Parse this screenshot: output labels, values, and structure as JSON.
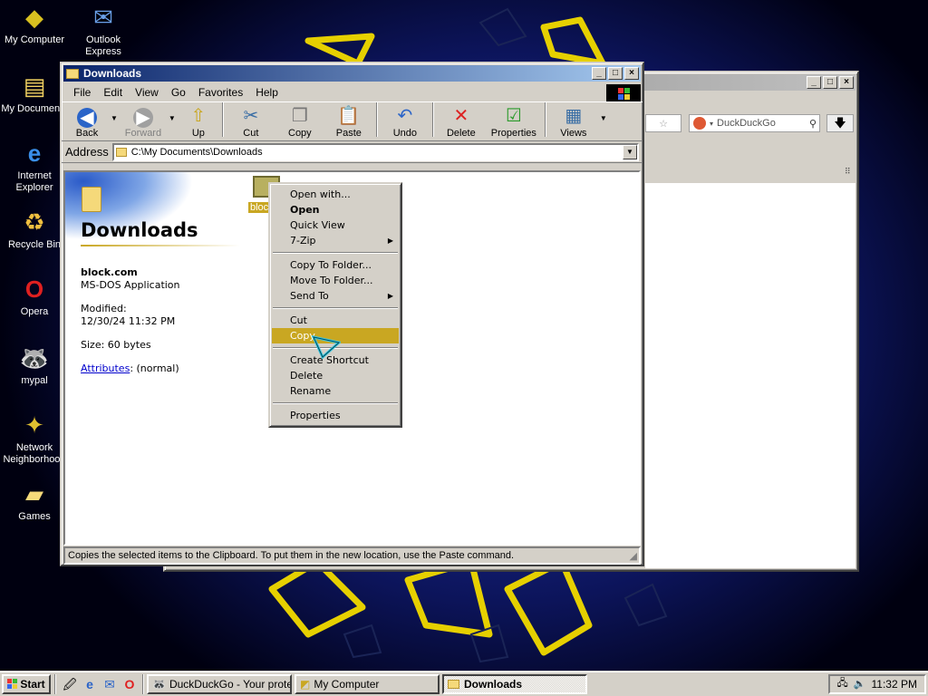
{
  "desktop": {
    "icons": [
      {
        "label": "My Computer",
        "icon": "my-computer-icon"
      },
      {
        "label": "Outlook Express",
        "icon": "outlook-express-icon"
      },
      {
        "label": "My Documents",
        "icon": "my-documents-icon"
      },
      {
        "label": "Internet Explorer",
        "icon": "internet-explorer-icon"
      },
      {
        "label": "Recycle Bin",
        "icon": "recycle-bin-icon"
      },
      {
        "label": "Opera",
        "icon": "opera-icon"
      },
      {
        "label": "mypal",
        "icon": "mypal-icon"
      },
      {
        "label": "Network Neighborhood",
        "icon": "network-neighborhood-icon"
      },
      {
        "label": "Games",
        "icon": "games-folder-icon"
      }
    ]
  },
  "background_window": {
    "search_placeholder": "DuckDuckGo"
  },
  "explorer": {
    "title": "Downloads",
    "menu": [
      "File",
      "Edit",
      "View",
      "Go",
      "Favorites",
      "Help"
    ],
    "toolbar": {
      "back": "Back",
      "forward": "Forward",
      "up": "Up",
      "cut": "Cut",
      "copy": "Copy",
      "paste": "Paste",
      "undo": "Undo",
      "delete": "Delete",
      "properties": "Properties",
      "views": "Views"
    },
    "address_label": "Address",
    "address_value": "C:\\My Documents\\Downloads",
    "left_panel": {
      "folder_title": "Downloads",
      "file_name": "block.com",
      "file_type": "MS-DOS Application",
      "modified_label": "Modified:",
      "modified_value": "12/30/24 11:32 PM",
      "size": "Size: 60 bytes",
      "attributes_link": "Attributes",
      "attributes_value": ": (normal)"
    },
    "file_item_label": "bloc",
    "status_text": "Copies the selected items to the Clipboard. To put them in the new location, use the Paste command."
  },
  "context_menu": {
    "items": [
      {
        "label": "Open with...",
        "type": "item"
      },
      {
        "label": "Open",
        "type": "bold"
      },
      {
        "label": "Quick View",
        "type": "item"
      },
      {
        "label": "7-Zip",
        "type": "submenu"
      },
      {
        "type": "separator"
      },
      {
        "label": "Copy To Folder...",
        "type": "item"
      },
      {
        "label": "Move To Folder...",
        "type": "item"
      },
      {
        "label": "Send To",
        "type": "submenu"
      },
      {
        "type": "separator"
      },
      {
        "label": "Cut",
        "type": "item"
      },
      {
        "label": "Copy",
        "type": "highlighted"
      },
      {
        "type": "separator"
      },
      {
        "label": "Create Shortcut",
        "type": "item"
      },
      {
        "label": "Delete",
        "type": "item"
      },
      {
        "label": "Rename",
        "type": "item"
      },
      {
        "type": "separator"
      },
      {
        "label": "Properties",
        "type": "item"
      }
    ]
  },
  "taskbar": {
    "start_label": "Start",
    "tasks": [
      {
        "label": "DuckDuckGo - Your prote...",
        "active": false
      },
      {
        "label": "My Computer",
        "active": false
      },
      {
        "label": "Downloads",
        "active": true
      }
    ],
    "clock": "11:32 PM"
  },
  "colors": {
    "title_active": "#0a246a",
    "menu_highlight": "#c9a722",
    "link": "#0000cc"
  }
}
